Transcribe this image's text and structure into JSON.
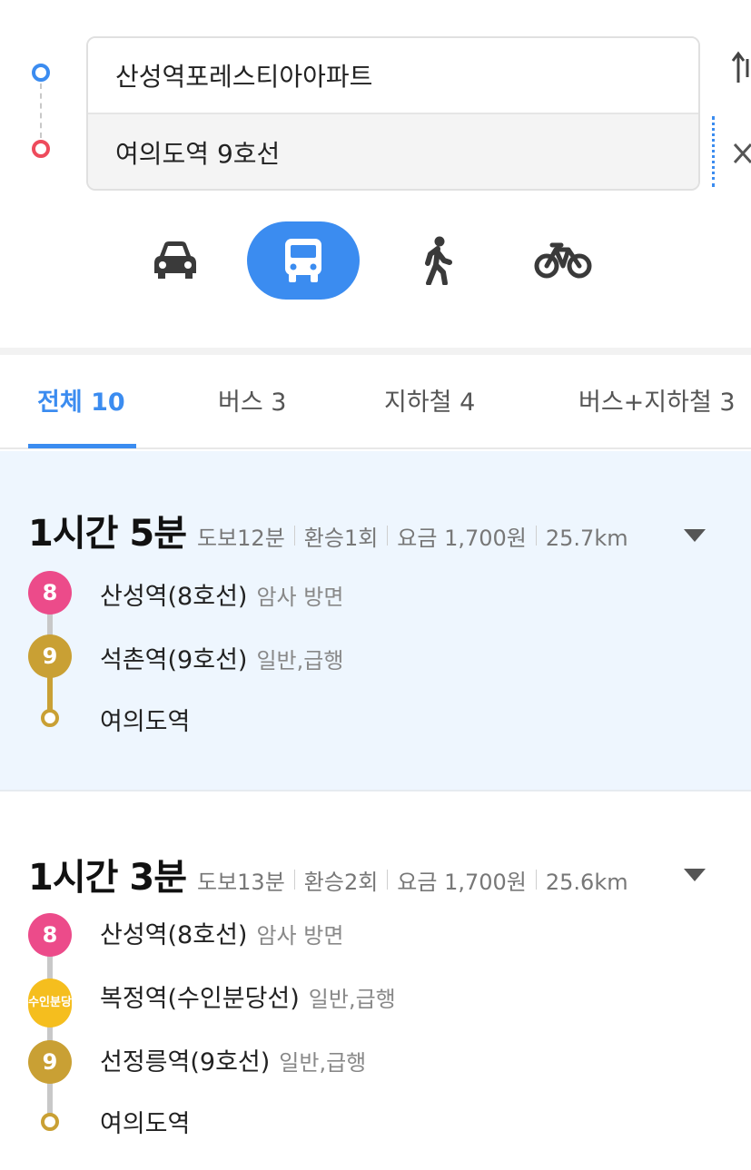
{
  "search": {
    "origin": "산성역포레스티아아파트",
    "destination": "여의도역 9호선"
  },
  "modes": [
    {
      "name": "car",
      "icon": "car-icon",
      "active": false
    },
    {
      "name": "bus",
      "icon": "bus-icon",
      "active": true
    },
    {
      "name": "walk",
      "icon": "walk-icon",
      "active": false
    },
    {
      "name": "bike",
      "icon": "bike-icon",
      "active": false
    }
  ],
  "tabs": [
    {
      "label": "전체 10",
      "active": true
    },
    {
      "label": "버스 3",
      "active": false
    },
    {
      "label": "지하철 4",
      "active": false
    },
    {
      "label": "버스+지하철 3",
      "active": false
    }
  ],
  "colors": {
    "accent": "#3b8cf0",
    "origin_pin": "#3b8cf0",
    "dest_pin": "#ee4b5c",
    "line8": "#ec4b8a",
    "line9": "#c9a034",
    "suin_bundang": "#f5be1e",
    "selected_card_bg": "#eef6fe"
  },
  "routes": [
    {
      "duration": "1시간 5분",
      "walk": "도보12분",
      "transfer": "환승1회",
      "fare": "요금 1,700원",
      "distance": "25.7km",
      "stops": [
        {
          "badge": "8",
          "name": "산성역(8호선)",
          "direction": "암사 방면"
        },
        {
          "badge": "9",
          "name": "석촌역(9호선)",
          "direction": "일반,급행"
        },
        {
          "badge": "",
          "name": "여의도역",
          "direction": ""
        }
      ]
    },
    {
      "duration": "1시간 3분",
      "walk": "도보13분",
      "transfer": "환승2회",
      "fare": "요금 1,700원",
      "distance": "25.6km",
      "stops": [
        {
          "badge": "8",
          "name": "산성역(8호선)",
          "direction": "암사 방면"
        },
        {
          "badge": "수인분당",
          "name": "복정역(수인분당선)",
          "direction": "일반,급행"
        },
        {
          "badge": "9",
          "name": "선정릉역(9호선)",
          "direction": "일반,급행"
        },
        {
          "badge": "",
          "name": "여의도역",
          "direction": ""
        }
      ]
    }
  ]
}
